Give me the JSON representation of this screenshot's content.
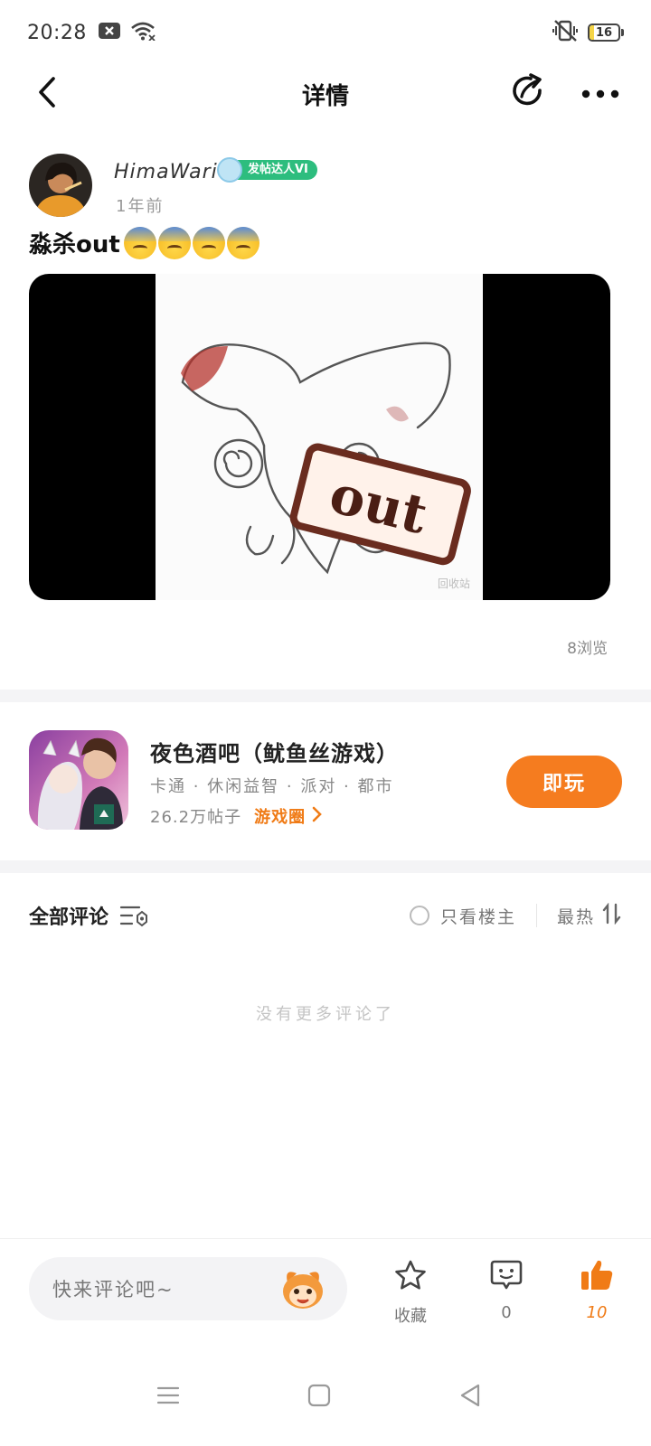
{
  "status_bar": {
    "time": "20:28",
    "battery_level": "16",
    "battery_fraction": 0.16,
    "icons": [
      "notification-x-icon",
      "wifi-icon",
      "vibrate-mute-icon",
      "battery-icon"
    ]
  },
  "nav": {
    "title": "详情",
    "icons": [
      "back-arrow-icon",
      "share-icon",
      "more-dots-icon"
    ]
  },
  "post": {
    "author_name": "HimaWari",
    "badge_label": "发帖达人VI",
    "time": "1年前",
    "text": "淼杀out",
    "emoji_count": 4,
    "emoji_name": "sweat-emoji",
    "media_label": "out",
    "media_watermark": "回收站",
    "views": "8浏览"
  },
  "game": {
    "name": "夜色酒吧（鱿鱼丝游戏）",
    "tags": "卡通 · 休闲益智 · 派对 · 都市",
    "posts": "26.2万帖子",
    "circle_link": "游戏圈",
    "play_label": "即玩"
  },
  "comments": {
    "title": "全部评论",
    "only_op_label": "只看楼主",
    "sort_label": "最热",
    "empty_text": "没有更多评论了"
  },
  "bottom_bar": {
    "input_placeholder": "快来评论吧~",
    "favorite_label": "收藏",
    "comment_count": "0",
    "like_count": "10",
    "colors": {
      "like_active": "#f07b16"
    }
  },
  "colors": {
    "accent_orange": "#f57c1f",
    "badge_green": "#2dbd7e"
  }
}
